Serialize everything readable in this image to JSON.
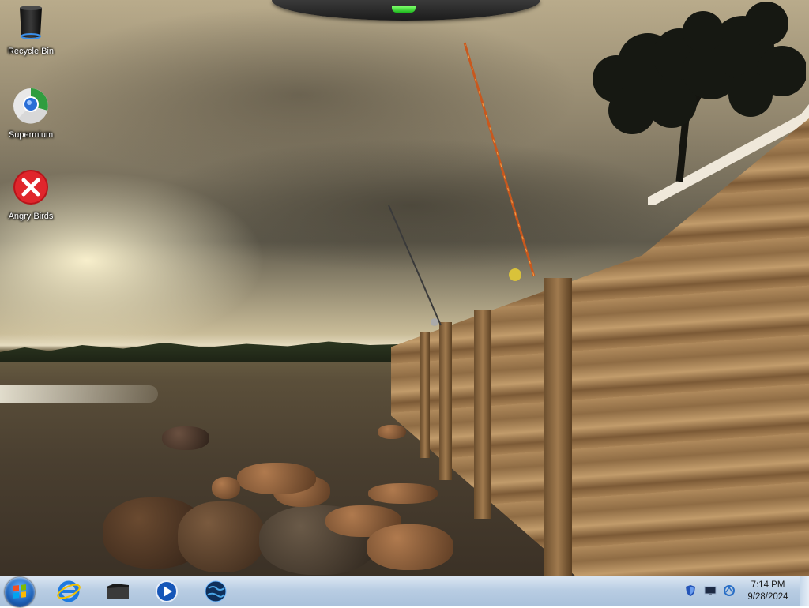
{
  "desktop": {
    "icons": [
      {
        "label": "Recycle Bin",
        "icon": "recycle-bin-icon"
      },
      {
        "label": "Supermium",
        "icon": "supermium-browser-icon"
      },
      {
        "label": "Angry Birds",
        "icon": "angry-birds-error-icon"
      }
    ],
    "wallpaper": "beach-fence-fishing-rods-photo"
  },
  "taskbar": {
    "start_button": "windows-start-orb",
    "pinned": [
      {
        "name": "Internet Explorer",
        "icon": "internet-explorer-icon"
      },
      {
        "name": "Folder",
        "icon": "dark-folder-icon"
      },
      {
        "name": "Media Player",
        "icon": "media-player-icon"
      },
      {
        "name": "Globe Browser",
        "icon": "globe-icon"
      }
    ],
    "tray_icons": [
      "shield-icon",
      "monitor-icon",
      "network-icon"
    ],
    "clock": {
      "time": "7:14 PM",
      "date": "9/28/2024"
    }
  },
  "colors": {
    "taskbar_top": "#dbe6f2",
    "taskbar_bottom": "#a9c1db",
    "gadget_led": "#3ddc2b"
  }
}
